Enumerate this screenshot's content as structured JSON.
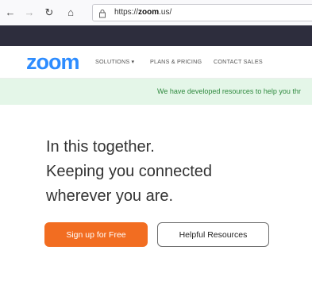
{
  "browser": {
    "back_icon": "←",
    "forward_icon": "→",
    "reload_icon": "↻",
    "home_icon": "⌂",
    "url_prefix": "https://",
    "url_domain": "zoom",
    "url_suffix": ".us/"
  },
  "header": {
    "logo": "zoom",
    "nav": [
      {
        "label": "SOLUTIONS ▾"
      },
      {
        "label": "PLANS & PRICING"
      },
      {
        "label": "CONTACT SALES"
      }
    ]
  },
  "banner": {
    "text": "We have developed resources to help you thr"
  },
  "hero": {
    "line1": "In this together.",
    "line2": "Keeping you connected",
    "line3": "wherever you are."
  },
  "cta": {
    "primary_label": "Sign up for Free",
    "secondary_label": "Helpful Resources"
  },
  "colors": {
    "brand_blue": "#2d8cff",
    "cta_orange": "#f26d21",
    "banner_bg": "#e4f6e8",
    "banner_text": "#2f8a3f",
    "dark_strip": "#2d2d3d"
  }
}
